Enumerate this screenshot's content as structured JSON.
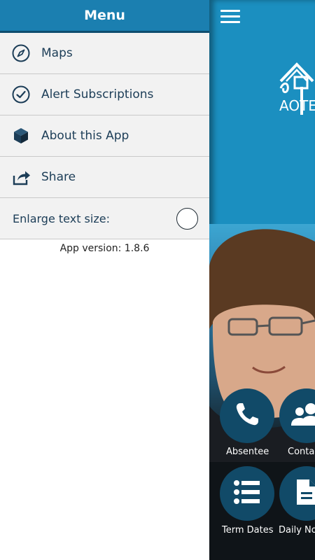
{
  "drawer": {
    "title": "Menu",
    "items": [
      {
        "label": "Maps",
        "icon": "compass-icon"
      },
      {
        "label": "Alert Subscriptions",
        "icon": "check-circle-icon"
      },
      {
        "label": "About this App",
        "icon": "cube-icon"
      },
      {
        "label": "Share",
        "icon": "share-icon"
      }
    ],
    "enlarge_label": "Enlarge text size:",
    "enlarge_enabled": false,
    "version": "App version: 1.8.6"
  },
  "main": {
    "logo_text": "AOTE",
    "buttons": [
      {
        "label": "Absentee",
        "icon": "phone-icon"
      },
      {
        "label": "Conta",
        "icon": "contacts-icon"
      },
      {
        "label": "Term Dates",
        "icon": "list-icon"
      },
      {
        "label": "Daily No",
        "icon": "document-icon"
      }
    ]
  },
  "colors": {
    "header": "#1b7fb0",
    "main_bg": "#1b8fc0",
    "menu_text": "#1c3d57",
    "button_bg": "#114a68"
  }
}
